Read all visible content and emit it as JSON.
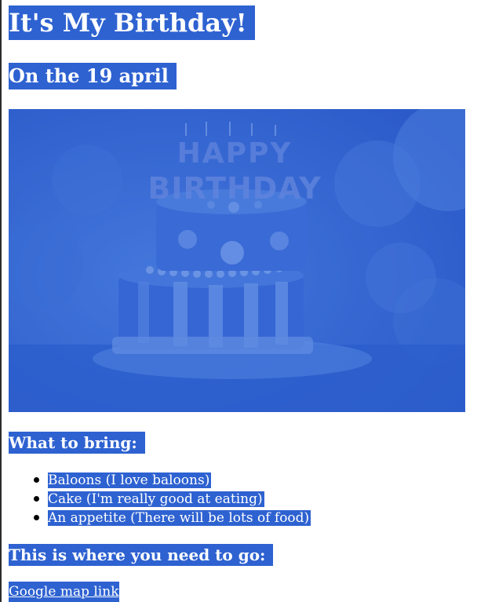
{
  "page": {
    "title": "It's My Birthday!",
    "date_heading": "On the 19 april",
    "highlight_color": "#2e62d1"
  },
  "hero_image": {
    "description": "birthday-cake-photo",
    "candles_text": "HAPPY BIRTHDAY"
  },
  "bring_section": {
    "heading": "What to bring:",
    "items": [
      "Baloons (I love baloons)",
      "Cake (I'm really good at eating)",
      "An appetite (There will be lots of food)"
    ]
  },
  "location_section": {
    "heading": "This is where you need to go:",
    "link_text": "Google map link"
  }
}
